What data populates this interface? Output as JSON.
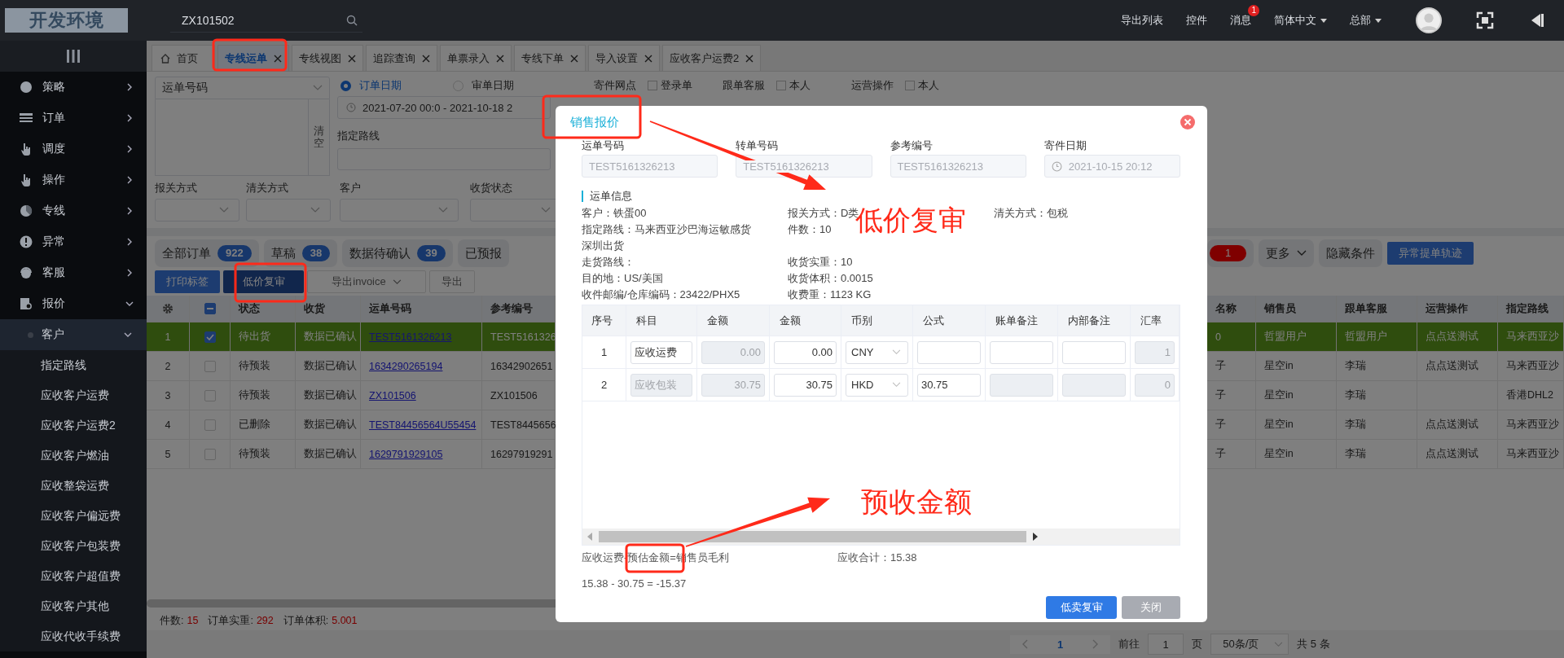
{
  "top_bar": {
    "logo": "开发环境",
    "search": {
      "value": "ZX101502"
    },
    "menu": [
      {
        "kind": "link",
        "label": "导出列表"
      },
      {
        "kind": "link",
        "label": "控件"
      },
      {
        "kind": "badge",
        "label": "消息",
        "badge": "1"
      },
      {
        "kind": "dropdown",
        "label": "简体中文"
      },
      {
        "kind": "dropdown",
        "label": "总部"
      }
    ]
  },
  "sidebar": {
    "items": [
      {
        "label": "策略",
        "expanded": false,
        "selected": false
      },
      {
        "label": "订单",
        "expanded": false,
        "selected": false
      },
      {
        "label": "调度",
        "expanded": false,
        "selected": false
      },
      {
        "label": "操作",
        "expanded": false,
        "selected": false
      },
      {
        "label": "专线",
        "expanded": false,
        "selected": false
      },
      {
        "label": "异常",
        "expanded": false,
        "selected": false
      },
      {
        "label": "客服",
        "expanded": false,
        "selected": false
      },
      {
        "label": "报价",
        "expanded": true,
        "selected": false,
        "children": [
          {
            "label": "客户",
            "expanded": true,
            "selected": true,
            "children": [
              {
                "label": "指定路线",
                "selected": false
              },
              {
                "label": "应收客户运费",
                "selected": false
              },
              {
                "label": "应收客户运费2",
                "selected": false
              },
              {
                "label": "应收客户燃油",
                "selected": false
              },
              {
                "label": "应收整袋运费",
                "selected": false
              },
              {
                "label": "应收客户偏远费",
                "selected": false
              },
              {
                "label": "应收客户包装费",
                "selected": false
              },
              {
                "label": "应收客户超值费",
                "selected": false
              },
              {
                "label": "应收客户其他",
                "selected": false
              },
              {
                "label": "应收代收手续费",
                "selected": false
              }
            ]
          }
        ]
      }
    ]
  },
  "tabs": [
    {
      "kind": "home",
      "label": "首页",
      "selected": false
    },
    {
      "kind": "page",
      "label": "专线运单",
      "selected": true
    },
    {
      "kind": "page",
      "label": "专线视图",
      "selected": false
    },
    {
      "kind": "page",
      "label": "追踪查询",
      "selected": false
    },
    {
      "kind": "page",
      "label": "单票录入",
      "selected": false
    },
    {
      "kind": "page",
      "label": "专线下单",
      "selected": false
    },
    {
      "kind": "page",
      "label": "导入设置",
      "selected": false
    },
    {
      "kind": "page",
      "label": "应收客户运费2",
      "selected": false
    }
  ],
  "filters": {
    "waybill_select": {
      "value": "运单号码"
    },
    "clear_button": "清空",
    "date_type": [
      {
        "label": "订单日期",
        "selected": true
      },
      {
        "label": "审单日期",
        "selected": false
      }
    ],
    "top_options": [
      {
        "kind": "label",
        "label": "寄件网点"
      },
      {
        "kind": "checkbox",
        "label": "登录单",
        "checked": false
      },
      {
        "kind": "label",
        "label": "跟单客服"
      },
      {
        "kind": "checkbox",
        "label": "本人",
        "checked": false
      },
      {
        "kind": "label",
        "label": "运营操作"
      },
      {
        "kind": "checkbox",
        "label": "本人",
        "checked": false
      }
    ],
    "date_range": {
      "value": "2021-07-20 00:0 - 2021-10-18 2"
    },
    "route_label": "指定路线",
    "selects": [
      {
        "label": "报关方式"
      },
      {
        "label": "清关方式"
      },
      {
        "label": "客户"
      },
      {
        "label": "收货状态"
      }
    ]
  },
  "status_tabs": {
    "left": [
      {
        "label": "全部订单",
        "count": "922"
      },
      {
        "label": "草稿",
        "count": "38"
      },
      {
        "label": "数据待确认",
        "count": "39"
      },
      {
        "label": "已预报"
      }
    ],
    "right": [
      {
        "kind": "count",
        "count": "1"
      },
      {
        "kind": "dropdown",
        "label": "更多"
      },
      {
        "kind": "plain",
        "label": "隐藏条件"
      },
      {
        "kind": "primary",
        "label": "异常提单轨迹"
      }
    ]
  },
  "actions": [
    {
      "kind": "primary",
      "label": "打印标签"
    },
    {
      "kind": "primary",
      "label": "低价复审"
    },
    {
      "kind": "dropdown",
      "label": "导出invoice"
    },
    {
      "kind": "plain",
      "label": "导出"
    }
  ],
  "table": {
    "header_check": {
      "indeterminate": true
    },
    "columns": [
      "状态",
      "收货",
      "运单号码",
      "参考编号"
    ],
    "right_columns": [
      "名称",
      "销售员",
      "跟单客服",
      "运营操作",
      "指定路线"
    ],
    "rows": [
      {
        "index": "1",
        "checked": true,
        "selected": true,
        "cells": [
          "待出货",
          "数据已确认",
          "TEST5161326213",
          "TEST5161326"
        ],
        "right_cells": [
          "0",
          "哲盟用户",
          "哲盟用户",
          "点点送测试",
          "马来西亚沙"
        ]
      },
      {
        "index": "2",
        "checked": false,
        "selected": false,
        "cells": [
          "待预装",
          "数据已确认",
          "1634290265194",
          "16342902651"
        ],
        "right_cells": [
          "子",
          "星空in",
          "李瑞",
          "点点送测试",
          "马来西亚沙"
        ]
      },
      {
        "index": "3",
        "checked": false,
        "selected": false,
        "cells": [
          "待预装",
          "数据已确认",
          "ZX101506",
          "ZX101506"
        ],
        "right_cells": [
          "子",
          "星空in",
          "李瑞",
          "",
          "香港DHL2"
        ]
      },
      {
        "index": "4",
        "checked": false,
        "selected": false,
        "cells": [
          "已删除",
          "数据已确认",
          "TEST84456564U55454",
          "TEST8445656"
        ],
        "right_cells": [
          "子",
          "星空in",
          "李瑞",
          "点点送测试",
          "马来西亚沙"
        ]
      },
      {
        "index": "5",
        "checked": false,
        "selected": false,
        "cells": [
          "待预装",
          "数据已确认",
          "1629791929105",
          "16297919291"
        ],
        "right_cells": [
          "子",
          "星空in",
          "李瑞",
          "点点送测试",
          "马来西亚沙"
        ]
      }
    ]
  },
  "summary": [
    {
      "label": "件数:",
      "value": "15"
    },
    {
      "label": "订单实重:",
      "value": "292"
    },
    {
      "label": "订单体积:",
      "value": "5.001"
    }
  ],
  "pagination": {
    "pages": [
      {
        "label": "1",
        "selected": true
      }
    ],
    "goto_label": "前往",
    "goto_value": "1",
    "page_unit": "页",
    "page_size": "50条/页",
    "total": "共 5 条"
  },
  "dialog": {
    "title": "销售报价",
    "fields": [
      {
        "kind": "text",
        "label": "运单号码",
        "value": "TEST5161326213"
      },
      {
        "kind": "text",
        "label": "转单号码",
        "value": "TEST5161326213"
      },
      {
        "kind": "text",
        "label": "参考编号",
        "value": "TEST5161326213"
      },
      {
        "kind": "date",
        "label": "寄件日期",
        "value": "2021-10-15 20:12"
      }
    ],
    "section_title": "运单信息",
    "info_rows": [
      [
        "客户：铁蛋00",
        "报关方式：D类",
        "清关方式：包税"
      ],
      [
        "指定路线：马来西亚沙巴海运敏感货深圳出货",
        "件数：10"
      ],
      [
        "走货路线：",
        "收货实重：10"
      ],
      [
        "目的地：US/美国",
        "收货体积：0.0015"
      ],
      [
        "收件邮编/仓库编码：23422/PHX5",
        "收费重：1123  KG"
      ]
    ],
    "columns": [
      "序号",
      "科目",
      "金额",
      "金额",
      "币别",
      "公式",
      "账单备注",
      "内部备注",
      "汇率"
    ],
    "rows": [
      {
        "cells": [
          {
            "kind": "text",
            "value": "1"
          },
          {
            "kind": "input",
            "value": "应收运费",
            "disabled": false
          },
          {
            "kind": "input",
            "value": "0.00",
            "disabled": true
          },
          {
            "kind": "input",
            "value": "0.00",
            "disabled": false
          },
          {
            "kind": "select",
            "value": "CNY"
          },
          {
            "kind": "input",
            "disabled": false
          },
          {
            "kind": "input",
            "disabled": false
          },
          {
            "kind": "input",
            "disabled": false
          },
          {
            "kind": "input",
            "value": "1",
            "disabled": true
          }
        ]
      },
      {
        "cells": [
          {
            "kind": "text",
            "value": "2"
          },
          {
            "kind": "input",
            "value": "应收包装",
            "disabled": true
          },
          {
            "kind": "input",
            "value": "30.75",
            "disabled": true
          },
          {
            "kind": "input",
            "value": "30.75",
            "disabled": false
          },
          {
            "kind": "select",
            "value": "HKD"
          },
          {
            "kind": "input",
            "value": "30.75",
            "disabled": false
          },
          {
            "kind": "input",
            "disabled": true
          },
          {
            "kind": "input",
            "disabled": true
          },
          {
            "kind": "input",
            "value": "0",
            "disabled": true
          }
        ]
      }
    ],
    "formula_note": "应收运费-预估金额=销售员毛利",
    "total": "应收合计：15.38",
    "formula_result": "15.38 - 30.75 = -15.37",
    "buttons": [
      {
        "kind": "primary",
        "label": "低卖复审"
      },
      {
        "kind": "secondary",
        "label": "关闭"
      }
    ]
  },
  "annotations": [
    {
      "kind": "box"
    },
    {
      "kind": "box"
    },
    {
      "kind": "box"
    },
    {
      "kind": "box"
    },
    {
      "kind": "arrow"
    },
    {
      "kind": "arrow"
    },
    {
      "kind": "label",
      "text": "低价复审"
    },
    {
      "kind": "label",
      "text": "预收金额"
    }
  ]
}
